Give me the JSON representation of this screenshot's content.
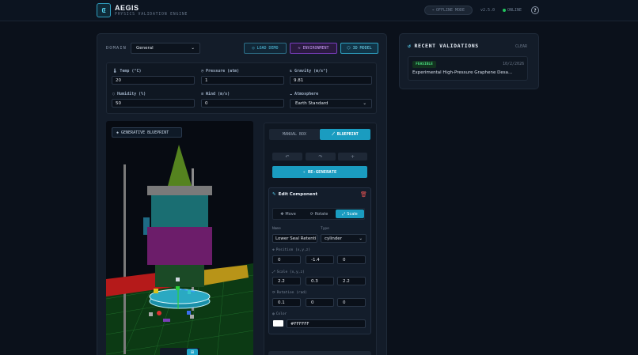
{
  "header": {
    "brand": "AEGIS",
    "subtitle": "PHYSICS VALIDATION ENGINE",
    "offline_mode": "OFFLINE MODE",
    "version": "v2.5.0",
    "status": "ONLINE"
  },
  "toolbar": {
    "domain_label": "DOMAIN",
    "domain_value": "General",
    "load_demo": "LOAD DEMO",
    "environment": "ENVIRONMENT",
    "model_3d": "3D MODEL"
  },
  "environment": {
    "temp": {
      "label": "Temp (°C)",
      "value": "20"
    },
    "pressure": {
      "label": "Pressure (atm)",
      "value": "1"
    },
    "gravity": {
      "label": "Gravity (m/s²)",
      "value": "9.81"
    },
    "humidity": {
      "label": "Humidity (%)",
      "value": "50"
    },
    "wind": {
      "label": "Wind (m/s)",
      "value": "0"
    },
    "atmosphere": {
      "label": "Atmosphere",
      "value": "Earth Standard"
    }
  },
  "viewport": {
    "badge": "GENERATIVE BLUEPRINT"
  },
  "side": {
    "tab_manual": "MANUAL BOX",
    "tab_blueprint": "BLUEPRINT",
    "undo": "↶",
    "redo": "↷",
    "add": "+",
    "regenerate": "RE-GENERATE"
  },
  "editor": {
    "title": "Edit Component",
    "mode_move": "Move",
    "mode_rotate": "Rotate",
    "mode_scale": "Scale",
    "name_label": "Name",
    "name_value": "Lower Seal Retenti",
    "type_label": "Type",
    "type_value": "cylinder",
    "position_label": "Position (x,y,z)",
    "position": [
      "0",
      "-1.4",
      "0"
    ],
    "scale_label": "Scale (x,y,z)",
    "scale": [
      "2.2",
      "0.3",
      "2.2"
    ],
    "rotation_label": "Rotation (rad)",
    "rotation": [
      "0.1",
      "0",
      "0"
    ],
    "color_label": "Color",
    "color_value": "#FFFFFF"
  },
  "recent": {
    "title": "RECENT VALIDATIONS",
    "clear": "CLEAR",
    "items": [
      {
        "status": "FEASIBLE",
        "date": "10/2/2026",
        "name": "Experimental High-Pressure Graphene Desa..."
      }
    ]
  },
  "colors": {
    "accent": "#1a9cc0",
    "purple": "#a855f7",
    "success": "#4ade80",
    "danger": "#e05252"
  }
}
